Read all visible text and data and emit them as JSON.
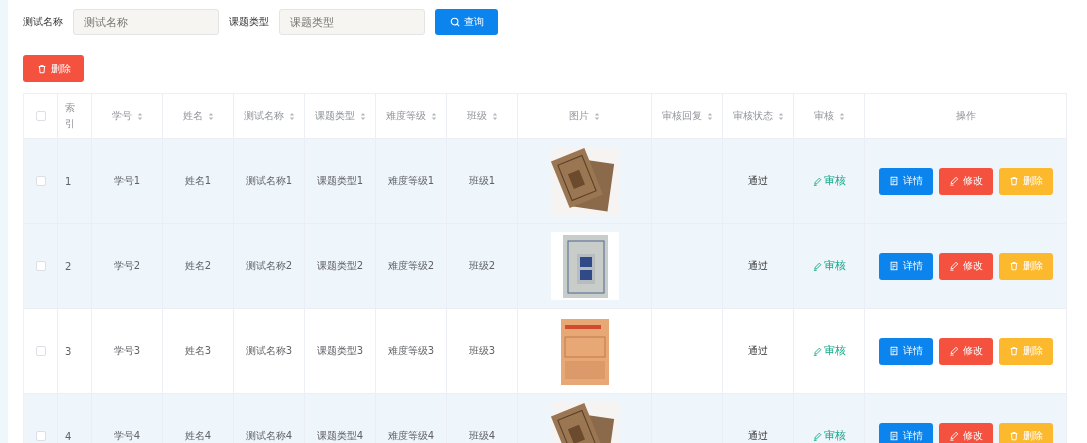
{
  "search": {
    "fields": [
      {
        "label": "测试名称",
        "placeholder": "测试名称"
      },
      {
        "label": "课题类型",
        "placeholder": "课题类型"
      }
    ],
    "query_button": "查询"
  },
  "delete_button": "删除",
  "table": {
    "select_all": {
      "checked": false
    },
    "columns": [
      {
        "label": "索引",
        "sortable": false
      },
      {
        "label": "学号",
        "sortable": true
      },
      {
        "label": "姓名",
        "sortable": true
      },
      {
        "label": "测试名称",
        "sortable": true
      },
      {
        "label": "课题类型",
        "sortable": true
      },
      {
        "label": "难度等级",
        "sortable": true
      },
      {
        "label": "班级",
        "sortable": true
      },
      {
        "label": "图片",
        "sortable": true
      },
      {
        "label": "审核回复",
        "sortable": true
      },
      {
        "label": "审核状态",
        "sortable": true
      },
      {
        "label": "审核",
        "sortable": true
      },
      {
        "label": "操作",
        "sortable": false
      }
    ],
    "rows": [
      {
        "checked": false,
        "shaded": true,
        "cells": [
          "1",
          "学号1",
          "姓名1",
          "测试名称1",
          "课题类型1",
          "难度等级1",
          "班级1"
        ],
        "picture": {
          "kind": "picture"
        },
        "reply": "",
        "status": "通过",
        "review": "审核",
        "actions": [
          "详情",
          "修改",
          "删除"
        ]
      },
      {
        "checked": false,
        "shaded": true,
        "cells": [
          "2",
          "学号2",
          "姓名2",
          "测试名称2",
          "课题类型2",
          "难度等级2",
          "班级2"
        ],
        "picture": {
          "kind": "picture"
        },
        "reply": "",
        "status": "通过",
        "review": "审核",
        "actions": [
          "详情",
          "修改",
          "删除"
        ]
      },
      {
        "checked": false,
        "shaded": false,
        "cells": [
          "3",
          "学号3",
          "姓名3",
          "测试名称3",
          "课题类型3",
          "难度等级3",
          "班级3"
        ],
        "picture": {
          "kind": "picture"
        },
        "reply": "",
        "status": "通过",
        "review": "审核",
        "actions": [
          "详情",
          "修改",
          "删除"
        ]
      },
      {
        "checked": false,
        "shaded": true,
        "cells": [
          "4",
          "学号4",
          "姓名4",
          "测试名称4",
          "课题类型4",
          "难度等级4",
          "班级4"
        ],
        "picture": {
          "kind": "picture"
        },
        "reply": "",
        "status": "通过",
        "review": "审核",
        "actions": [
          "详情",
          "修改",
          "删除"
        ]
      }
    ]
  }
}
